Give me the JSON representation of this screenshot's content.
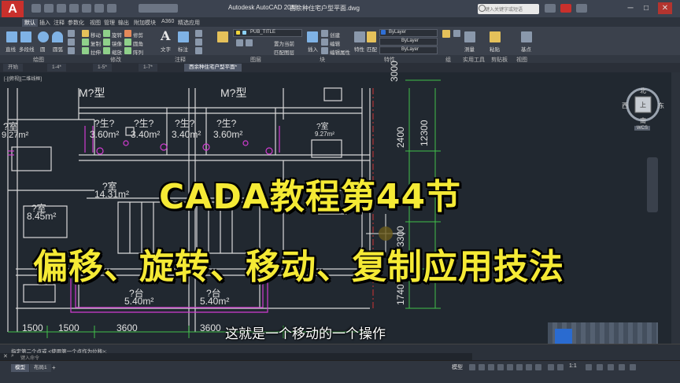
{
  "window": {
    "logo": "A",
    "title": "Autodesk AutoCAD 2018",
    "file": "西余种住宅户型平面.dwg",
    "search_placeholder": "键入关键字或短语",
    "minimize": "─",
    "maximize": "□",
    "close": "✕"
  },
  "ribbon_tabs": [
    "默认",
    "插入",
    "注释",
    "参数化",
    "视图",
    "管理",
    "输出",
    "附加模块",
    "A360",
    "精选应用"
  ],
  "ribbon": {
    "draw_tools": [
      "直线",
      "多段线",
      "圆",
      "圆弧"
    ],
    "modify_tools": [
      "移动",
      "旋转",
      "修剪",
      "复制",
      "镜像",
      "圆角",
      "拉伸",
      "缩放",
      "阵列"
    ],
    "annotation_tools": [
      "文字",
      "标注"
    ],
    "layer_dropdown": "PUB_TITLE",
    "layer_tools": [
      "置为当前",
      "匹配图层"
    ],
    "block_tools": [
      "插入",
      "创建",
      "编辑",
      "编辑属性"
    ],
    "prop_tools": [
      "特性",
      "匹配"
    ],
    "bylayer": [
      "ByLayer",
      "ByLayer",
      "ByLayer"
    ],
    "util_tools": [
      "测量"
    ],
    "clip_tools": [
      "粘贴"
    ],
    "view_tools": [
      "基点"
    ],
    "group_labels": [
      "绘图",
      "修改",
      "注释",
      "图层",
      "块",
      "特性",
      "组",
      "实用工具",
      "剪贴板",
      "视图"
    ]
  },
  "doc_tabs": [
    "开始",
    "1-4*",
    "1-5*",
    "1-7*",
    "西余种住宅户型平面*"
  ],
  "viewport_label": "[-][俯视][二维线框]",
  "viewcube": {
    "north": "北",
    "south": "南",
    "east": "东",
    "west": "西",
    "top": "上",
    "wcs": "WCS"
  },
  "drawing_labels": {
    "room_m1": "M?型",
    "room_m2": "M?型",
    "bath1": "?生?",
    "bath2": "?生?",
    "bath3": "?生?",
    "bath4": "?生?",
    "bath_area1": "3.60m²",
    "bath_area2": "3.40m²",
    "bath_area3": "3.40m²",
    "bath_area4": "3.60m²",
    "room_left": "?室",
    "room_left_area": "9.27m²",
    "room_right": "?室",
    "room_right_area": "9.27m²",
    "room_center": "?室",
    "room_center_area": "14.31m²",
    "room_sw": "?室",
    "room_sw_area": "8.45m²",
    "balcony1": "?台",
    "balcony1_area": "5.40m²",
    "balcony2": "?台",
    "balcony2_area": "5.40m²",
    "dim_1500a": "1500",
    "dim_1500b": "1500",
    "dim_3600a": "3600",
    "dim_3600b": "3600",
    "dim_3000": "3000",
    "dim_2400": "2400",
    "dim_12300": "12300",
    "dim_3300": "3300",
    "dim_1740": "1740"
  },
  "overlay": {
    "title_line1": "CADA教程第44节",
    "title_line2": "偏移、旋转、移动、复制应用技法",
    "subtitle": "这就是一个移动的一个操作"
  },
  "command": {
    "history": "指定第二个点或 <使用第一个点作为位移>:",
    "prompt": "键入命令"
  },
  "status": {
    "layout_tabs": [
      "模型",
      "布局1"
    ],
    "model_label": "模型",
    "scale": "1:1"
  }
}
